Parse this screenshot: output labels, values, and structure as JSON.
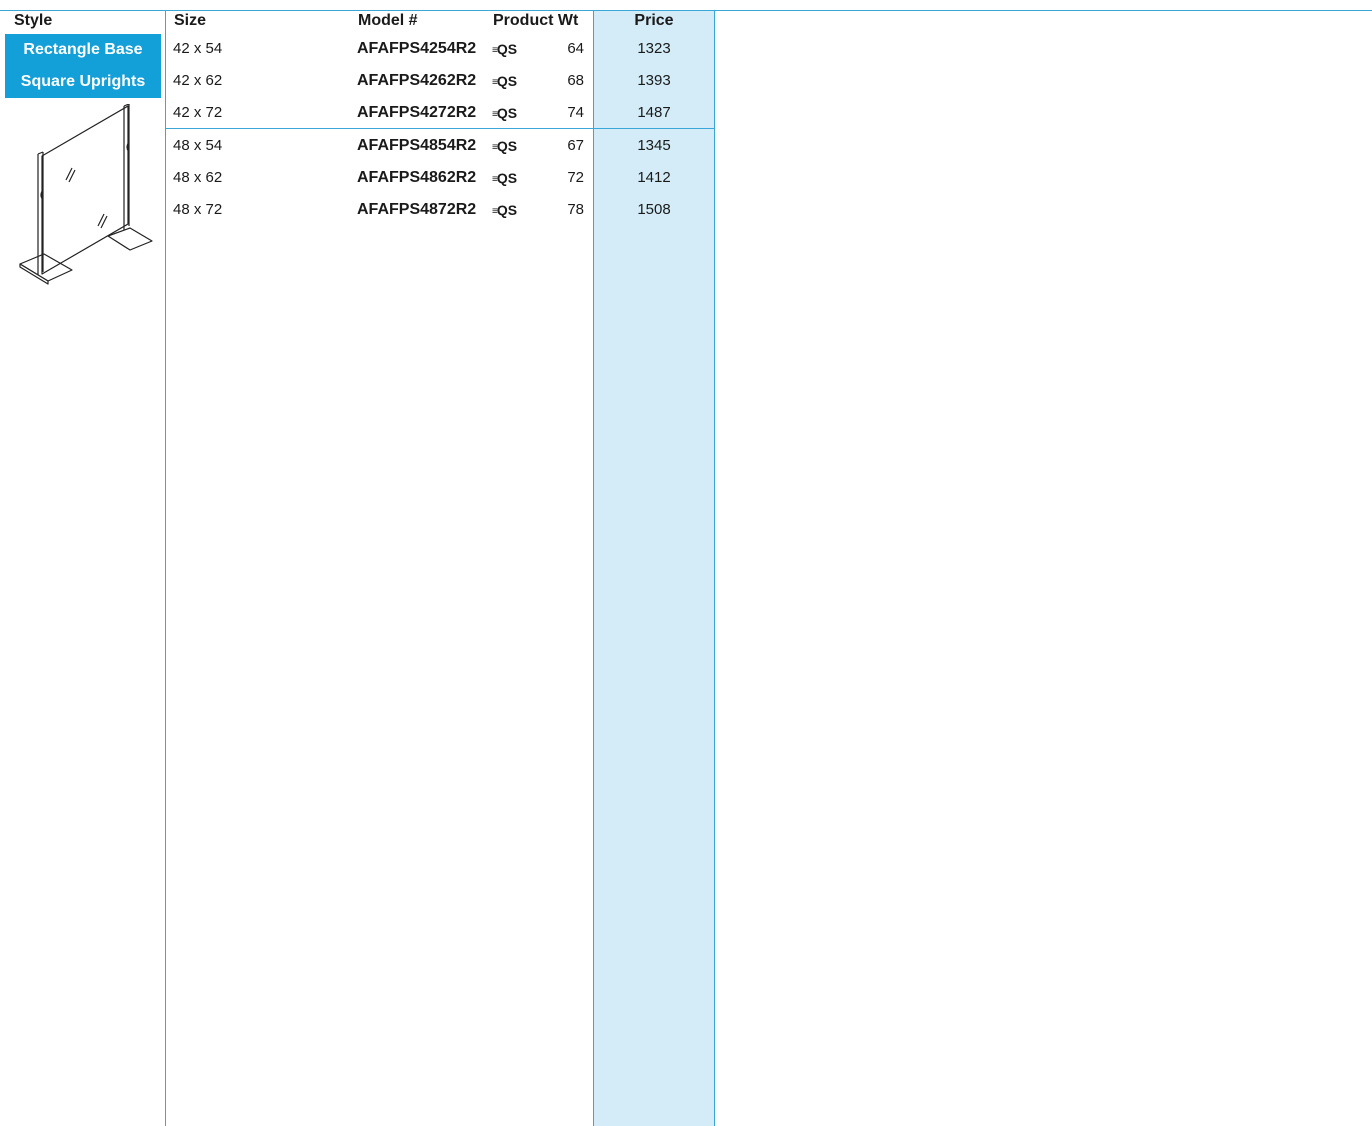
{
  "header": {
    "style": "Style",
    "size": "Size",
    "model": "Model #",
    "weight": "Product Wt",
    "price": "Price"
  },
  "style_labels": [
    "Rectangle Base",
    "Square Uprights"
  ],
  "qs_badge": "QS",
  "rows": [
    {
      "size": "42 x 54",
      "model": "AFAFPS4254R2",
      "weight": "64",
      "price": "1323"
    },
    {
      "size": "42 x 62",
      "model": "AFAFPS4262R2",
      "weight": "68",
      "price": "1393"
    },
    {
      "size": "42 x 72",
      "model": "AFAFPS4272R2",
      "weight": "74",
      "price": "1487"
    },
    {
      "size": "48 x 54",
      "model": "AFAFPS4854R2",
      "weight": "67",
      "price": "1345"
    },
    {
      "size": "48 x 62",
      "model": "AFAFPS4862R2",
      "weight": "72",
      "price": "1412"
    },
    {
      "size": "48 x 72",
      "model": "AFAFPS4872R2",
      "weight": "78",
      "price": "1508"
    }
  ],
  "colors": {
    "accent": "#13a0d9",
    "price_bg": "#d3ecf7",
    "rule": "#3aa7d8"
  }
}
